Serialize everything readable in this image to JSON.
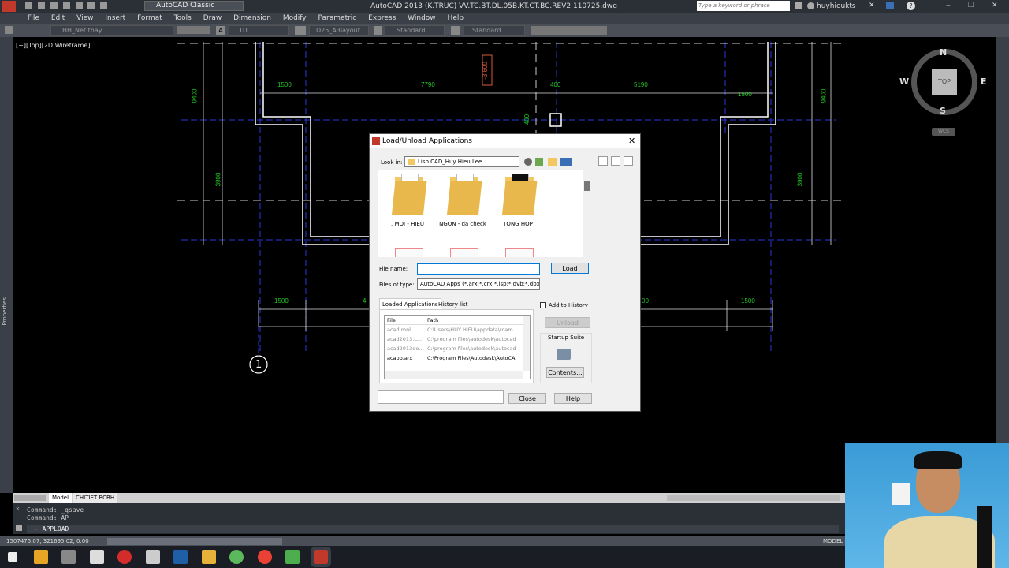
{
  "app": {
    "title": "AutoCAD 2013    (K.TRUC) VV.TC.BT.DL.05B.KT.CT.BC.REV2.110725.dwg",
    "workspace": "AutoCAD Classic",
    "search_placeholder": "Type a keyword or phrase",
    "user": "huyhieukts"
  },
  "menu": [
    "File",
    "Edit",
    "View",
    "Insert",
    "Format",
    "Tools",
    "Draw",
    "Dimension",
    "Modify",
    "Parametric",
    "Express",
    "Window",
    "Help"
  ],
  "toolbar2": {
    "layer": "HH_Net thay",
    "textstyle": "TIT",
    "dimstyle": "D25_A3layout",
    "tablestyle": "Standard",
    "multileader": "Standard"
  },
  "viewport": {
    "label": "[−][Top][2D Wireframe]",
    "viewcube": {
      "n": "N",
      "s": "S",
      "e": "E",
      "w": "W",
      "top": "TOP",
      "wcs": "WCS"
    },
    "dims_top": [
      "1500",
      "7790",
      "400",
      "5190",
      "1500"
    ],
    "dims_side": [
      "9400",
      "3900",
      "9400",
      "3900",
      "400",
      "-3.600"
    ],
    "dims_bottom": [
      "1500",
      "4",
      "00",
      "1500"
    ],
    "grid_bubble": "1"
  },
  "left_palette": "Properties",
  "tabs": {
    "model": "Model",
    "layout": "CHITIET BCBH"
  },
  "command": {
    "lines": [
      "Command: _qsave",
      "Command: AP"
    ],
    "prompt": "- APPLOAD"
  },
  "status": {
    "coords": "1507475.07, 321695.02, 0.00",
    "mode": "MODEL"
  },
  "dialog": {
    "title": "Load/Unload Applications",
    "look_in_label": "Look in:",
    "look_in_value": "Lisp CAD_Huy Hieu Lee",
    "folders": [
      ". MOI - HIEU",
      "NGON - da check",
      "TONG HOP"
    ],
    "file_name_label": "File name:",
    "file_name_value": "",
    "files_of_type_label": "Files of type:",
    "files_of_type_value": "AutoCAD Apps (*.arx;*.crx;*.lsp;*.dvb;*.dbx;*.",
    "load_btn": "Load",
    "add_to_history": "Add to History",
    "unload_btn": "Unload",
    "startup_suite": "Startup Suite",
    "contents_btn": "Contents...",
    "tab_loaded": "Loaded Applications",
    "tab_history": "History list",
    "col_file": "File",
    "col_path": "Path",
    "rows": [
      {
        "file": "acad.mnl",
        "path": "C:\\Users\\HUY HIEU\\appdata\\roam"
      },
      {
        "file": "acad2013.L...",
        "path": "C:\\program files\\autodesk\\autocad"
      },
      {
        "file": "acad2013do...",
        "path": "C:\\program files\\autodesk\\autocad"
      },
      {
        "file": "acapp.arx",
        "path": "C:\\Program Files\\Autodesk\\AutoCA"
      }
    ],
    "close_btn": "Close",
    "help_btn": "Help"
  },
  "colors": {
    "dim_green": "#22c522",
    "wall_white": "#ffffff",
    "axis_blue": "#2a39d6",
    "accent": "#0078d7"
  }
}
